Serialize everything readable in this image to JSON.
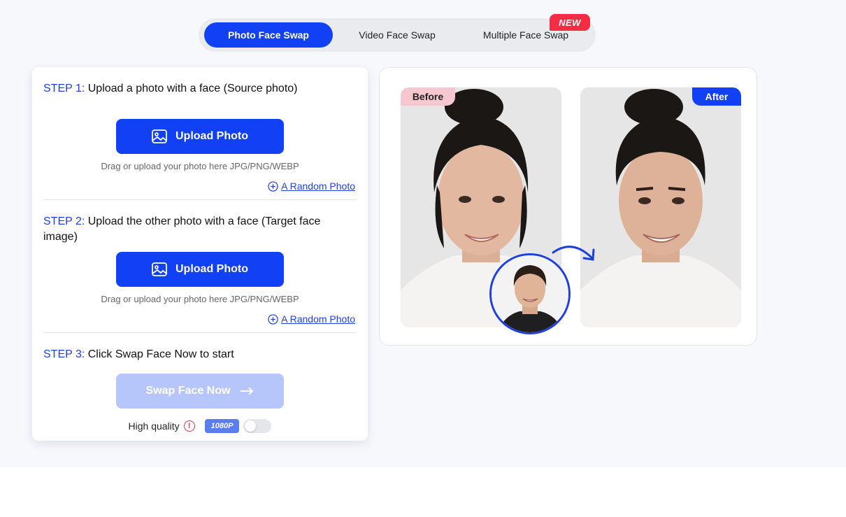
{
  "tabs": {
    "photo": "Photo Face Swap",
    "video": "Video Face Swap",
    "multiple": "Multiple Face Swap",
    "new_badge": "NEW"
  },
  "step1": {
    "label": "STEP 1:",
    "text": " Upload a photo with a face (Source photo)",
    "upload_label": "Upload Photo",
    "hint": "Drag or upload your photo here JPG/PNG/WEBP",
    "random": "A Random Photo"
  },
  "step2": {
    "label": "STEP 2:",
    "text": " Upload the other photo with a face (Target face image)",
    "upload_label": "Upload Photo",
    "hint": "Drag or upload your photo here JPG/PNG/WEBP",
    "random": "A Random Photo"
  },
  "step3": {
    "label": "STEP 3:",
    "text": " Click Swap Face Now to start",
    "swap_label": "Swap Face Now",
    "quality_label": "High quality",
    "resolution_badge": "1080P",
    "quality_enabled": false
  },
  "preview": {
    "before_tag": "Before",
    "after_tag": "After"
  },
  "icons": {
    "upload": "image-icon",
    "random": "plus-circle-icon",
    "swap_arrow": "arrow-right-icon",
    "warning": "warning-icon",
    "curve_arrow": "curved-arrow-icon"
  },
  "colors": {
    "primary": "#1140f5",
    "primary_disabled": "#b6c6fb",
    "step_label": "#1e3fe0",
    "new_badge": "#f42d45",
    "before_tag": "#f7c7d0"
  }
}
